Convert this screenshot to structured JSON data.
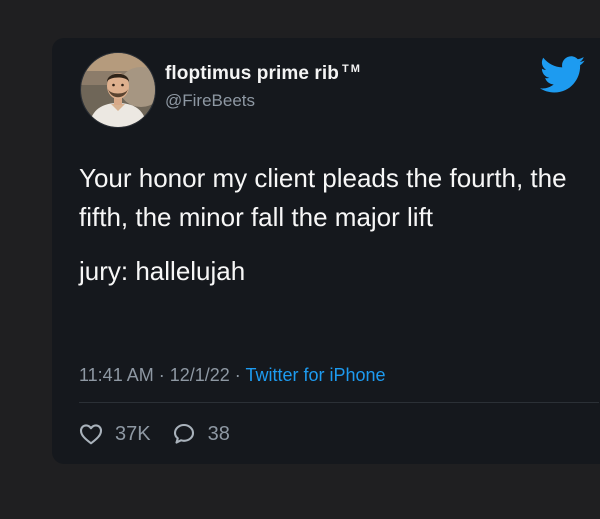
{
  "tweet": {
    "author": {
      "display_name": "floptimus prime rib",
      "name_suffix": "TM",
      "handle": "@FireBeets"
    },
    "paragraphs": [
      "Your honor my client pleads the fourth, the fifth, the minor fall the major lift",
      "jury: hallelujah"
    ],
    "meta": {
      "time": "11:41 AM",
      "separator_1": " · ",
      "date": "12/1/22",
      "separator_2": " · ",
      "source": "Twitter for iPhone"
    },
    "stats": {
      "likes": "37K",
      "replies": "38"
    }
  },
  "icons": {
    "brand": "twitter-bird-icon",
    "like": "heart-icon",
    "reply": "reply-icon"
  },
  "colors": {
    "background": "#1f1f21",
    "card": "#15181d",
    "text": "#f7f7f7",
    "secondary_text": "#8e98a3",
    "accent": "#1d9bf0"
  }
}
